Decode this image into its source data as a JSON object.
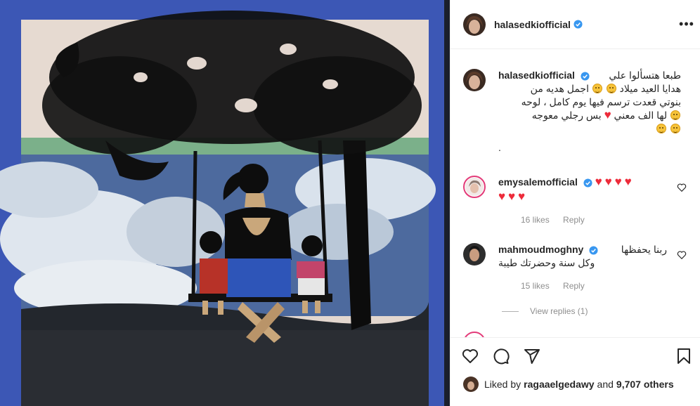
{
  "post": {
    "author": "halasedkiofficial",
    "more_icon": "more-horizontal-icon"
  },
  "caption": {
    "author": "halasedkiofficial",
    "line1": "طبعا هتسألوا علي",
    "line2": "هدايا العيد ميلاد",
    "line2b": "اجمل هديه من",
    "line3": "بنوتي قعدت ترسم فيها يوم كامل ، لوحه",
    "line4a": "لها الف معني",
    "line4b": "بس رجلي معوجه",
    "trailing": "."
  },
  "comments": [
    {
      "author": "emysalemofficial",
      "text": "",
      "likes": "16 likes",
      "reply": "Reply"
    },
    {
      "author": "mahmoudmoghny",
      "line1": "ربنا يحفظها",
      "line2": "وكل سنة وحضرتك طيبة",
      "likes": "15 likes",
      "reply": "Reply",
      "view_replies": "View replies (1)"
    }
  ],
  "actions": {
    "like_icon": "heart-icon",
    "comment_icon": "comment-icon",
    "share_icon": "share-icon",
    "save_icon": "bookmark-icon"
  },
  "liked_by": {
    "prefix": "Liked by",
    "user": "ragaaelgedawy",
    "and": "and",
    "others": "9,707 others"
  },
  "colors": {
    "verified": "#3897f0",
    "heart": "#ed2b3a",
    "frame_blue": "#3b57b8"
  }
}
